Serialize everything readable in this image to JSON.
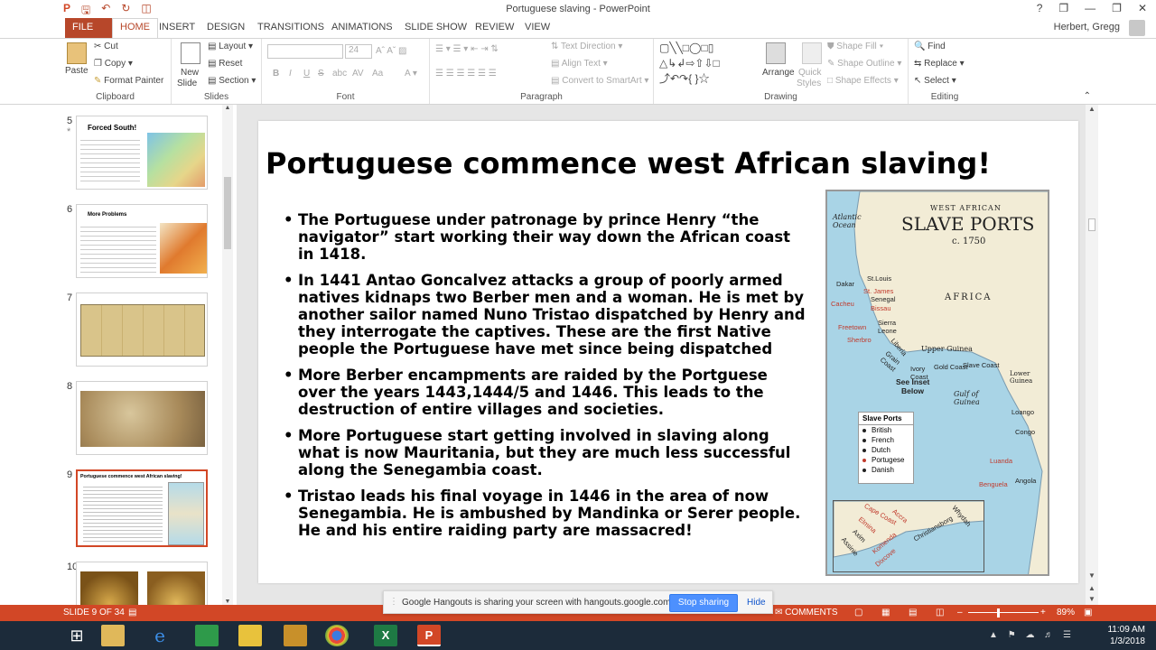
{
  "window": {
    "title": "Portuguese slaving - PowerPoint",
    "help": "?",
    "minimize": "—",
    "restore": "❐",
    "close": "✕"
  },
  "tabs": [
    {
      "label": "FILE"
    },
    {
      "label": "HOME"
    },
    {
      "label": "INSERT"
    },
    {
      "label": "DESIGN"
    },
    {
      "label": "TRANSITIONS"
    },
    {
      "label": "ANIMATIONS"
    },
    {
      "label": "SLIDE SHOW"
    },
    {
      "label": "REVIEW"
    },
    {
      "label": "VIEW"
    }
  ],
  "user": "Herbert, Gregg",
  "ribbon": {
    "clipboard": {
      "paste": "Paste",
      "cut": "Cut",
      "copy": "Copy",
      "format_painter": "Format Painter",
      "label": "Clipboard"
    },
    "slides": {
      "new_slide": "New",
      "new_slide2": "Slide",
      "layout": "Layout",
      "reset": "Reset",
      "section": "Section",
      "label": "Slides"
    },
    "font": {
      "size": "24",
      "label": "Font",
      "bold": "B",
      "italic": "I",
      "underline": "U",
      "strike": "S",
      "shadow": "abc",
      "spacing": "AV",
      "case": "Aa"
    },
    "paragraph": {
      "text_direction": "Text Direction",
      "align_text": "Align Text",
      "smartart": "Convert to SmartArt",
      "label": "Paragraph"
    },
    "drawing": {
      "arrange": "Arrange",
      "quick1": "Quick",
      "quick2": "Styles",
      "shape_fill": "Shape Fill",
      "shape_outline": "Shape Outline",
      "shape_effects": "Shape Effects",
      "label": "Drawing"
    },
    "editing": {
      "find": "Find",
      "replace": "Replace",
      "select": "Select",
      "label": "Editing"
    }
  },
  "thumbnails": [
    {
      "num": "5",
      "title": "Forced South!"
    },
    {
      "num": "6",
      "title": "More Problems"
    },
    {
      "num": "7",
      "title": ""
    },
    {
      "num": "8",
      "title": ""
    },
    {
      "num": "9",
      "title": "Portuguese commence west African slaving!"
    },
    {
      "num": "10",
      "title": ""
    }
  ],
  "slide": {
    "title": "Portuguese commence west African slaving!",
    "bullets": [
      "The Portuguese under patronage by prince Henry “the navigator” start working their way down the African coast in 1418.",
      "In 1441 Antao Goncalvez attacks a group of poorly armed natives kidnaps two Berber men and a woman. He is met by another sailor  named Nuno Tristao dispatched by Henry and they interrogate the captives. These are the first Native people the Portuguese have met since being dispatched",
      "More Berber encampments are raided by  the Portguese over the years 1443,1444/5 and 1446. This leads to the destruction of entire villages and societies.",
      "More Portuguese start getting involved in slaving along what is now Mauritania, but they are much less successful along the Senegambia coast.",
      "Tristao  leads his final voyage in 1446  in the area of now Senegambia. He is ambushed by Mandinka or Serer people. He and his entire raiding party are massacred!"
    ],
    "map": {
      "heading1": "WEST AFRICAN",
      "heading2": "SLAVE PORTS",
      "year": "c. 1750",
      "ocean": "Atlantic Ocean",
      "africa": "AFRICA",
      "upper_guinea": "Upper Guinea",
      "lower_guinea": "Lower Guinea",
      "gulf": "Gulf of Guinea",
      "see_inset1": "See Inset",
      "see_inset2": "Below",
      "places": [
        "Dakar",
        "St.Louis",
        "St. James",
        "Senegal",
        "Cacheu",
        "Bissau",
        "Freetown",
        "Sierra Leone",
        "Sherbro",
        "Liberia",
        "Grain Coast",
        "Ivory Coast",
        "Gold Coast",
        "Slave Coast",
        "Loango",
        "Congo",
        "Luanda",
        "Benguela",
        "Angola"
      ],
      "legend_title": "Slave Ports",
      "legend": [
        {
          "name": "British",
          "color": "#222222"
        },
        {
          "name": "French",
          "color": "#222222"
        },
        {
          "name": "Dutch",
          "color": "#222222"
        },
        {
          "name": "Portugese",
          "color": "#c0392b"
        },
        {
          "name": "Danish",
          "color": "#222222"
        }
      ],
      "inset_places": [
        "Cape Coast",
        "Accra",
        "Elmina",
        "Christiansborg",
        "Axim",
        "Komenda",
        "Assinie",
        "Whydah",
        "Dixcove"
      ]
    }
  },
  "notification": {
    "text": "Google Hangouts is sharing your screen with hangouts.google.com.",
    "stop": "Stop sharing",
    "hide": "Hide"
  },
  "status": {
    "slide_of": "SLIDE 9 OF 34",
    "comments": "COMMENTS",
    "zoom": "89%"
  },
  "clock": {
    "time": "11:09 AM",
    "date": "1/3/2018"
  },
  "colors": {
    "accent": "#d24726",
    "taskbar": "#1c2b3a"
  }
}
